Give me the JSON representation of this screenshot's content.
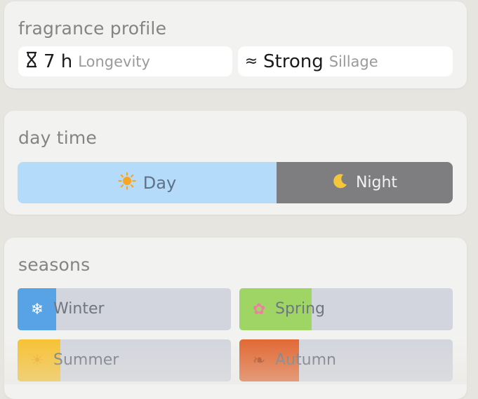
{
  "fragrance_profile": {
    "title": "fragrance profile",
    "longevity": {
      "icon": "hourglass-icon",
      "glyph": "⌛",
      "value": "7 h",
      "label": "Longevity"
    },
    "sillage": {
      "icon": "waves-icon",
      "glyph": "≈",
      "value": "Strong",
      "label": "Sillage"
    }
  },
  "day_time": {
    "title": "day time",
    "day": {
      "icon": "sun-icon",
      "label": "Day",
      "color": "#b4dcfa",
      "fraction": 0.595
    },
    "night": {
      "icon": "moon-icon",
      "label": "Night",
      "color": "#7e7e80",
      "fraction": 0.405
    }
  },
  "seasons": {
    "title": "seasons",
    "items": [
      {
        "icon": "snowflake-icon",
        "glyph": "❄",
        "label": "Winter",
        "color": "#58a2e6",
        "fraction": 0.18
      },
      {
        "icon": "blossom-icon",
        "glyph": "✿",
        "label": "Spring",
        "color": "#9fd564",
        "fraction": 0.34
      },
      {
        "icon": "sun-icon",
        "glyph": "☀",
        "label": "Summer",
        "color": "#f7c12e",
        "fraction": 0.2
      },
      {
        "icon": "leaf-icon",
        "glyph": "❧",
        "label": "Autumn",
        "color": "#e2642e",
        "fraction": 0.28
      }
    ]
  }
}
